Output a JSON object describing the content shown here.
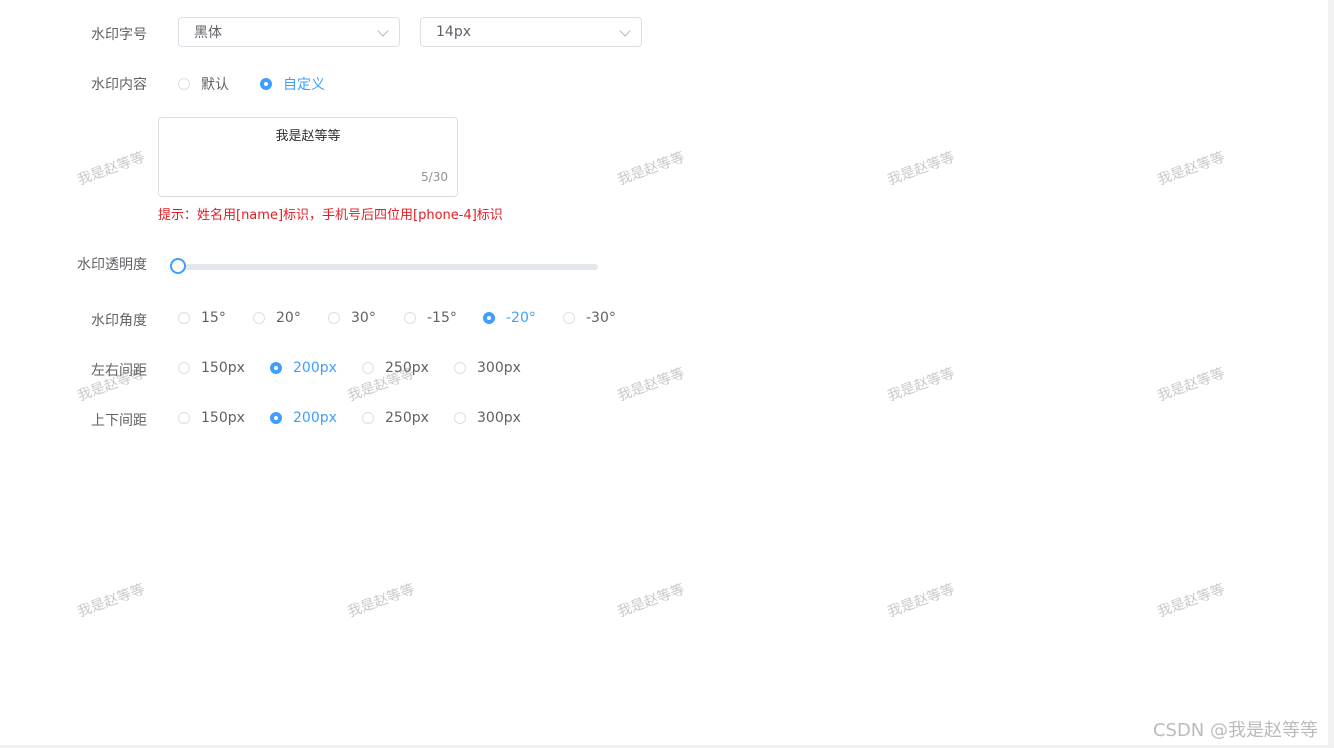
{
  "font_row": {
    "label": "水印字号",
    "family_select": "黑体",
    "size_select": "14px"
  },
  "content_row": {
    "label": "水印内容",
    "options": [
      "默认",
      "自定义"
    ],
    "selected": "自定义"
  },
  "textarea": {
    "value": "我是赵等等",
    "count": "5/30"
  },
  "hint": "提示：姓名用[name]标识，手机号后四位用[phone-4]标识",
  "opacity_row": {
    "label": "水印透明度",
    "value": 0
  },
  "angle_row": {
    "label": "水印角度",
    "options": [
      "15°",
      "20°",
      "30°",
      "-15°",
      "-20°",
      "-30°"
    ],
    "selected": "-20°"
  },
  "horizontal_row": {
    "label": "左右间距",
    "options": [
      "150px",
      "200px",
      "250px",
      "300px"
    ],
    "selected": "200px"
  },
  "vertical_row": {
    "label": "上下间距",
    "options": [
      "150px",
      "200px",
      "250px",
      "300px"
    ],
    "selected": "200px"
  },
  "watermark_text": "我是赵等等",
  "csdn_watermark": "CSDN @我是赵等等",
  "colors": {
    "accent": "#409eff",
    "hint": "#e51c23",
    "text": "#606266",
    "border": "#dcdfe6",
    "watermark": "#c9c9c9"
  }
}
